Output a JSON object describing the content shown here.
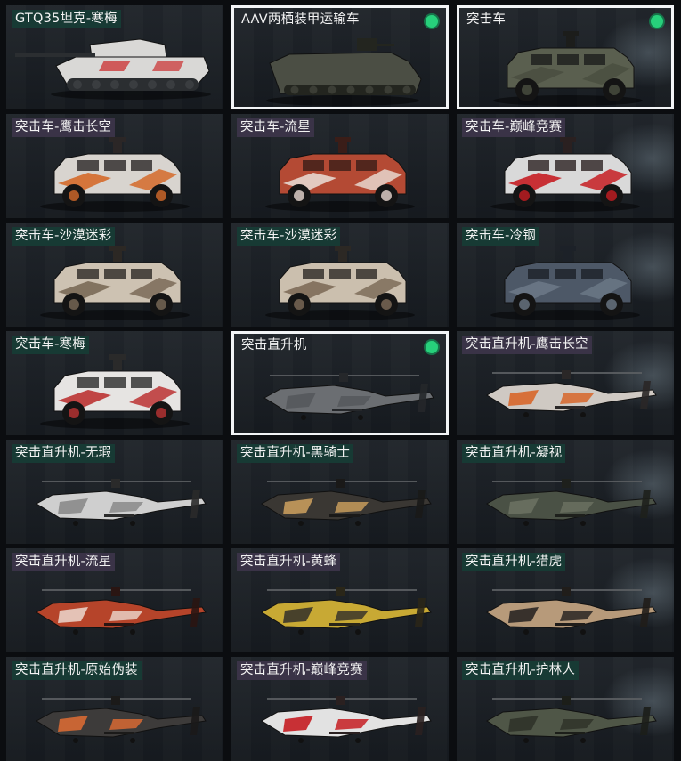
{
  "colors": {
    "background": "#0b0d10",
    "card": "#1a1f25",
    "selected_border": "#f2f4f6",
    "check": "#27d07b",
    "tag_teal": "#173a34",
    "tag_purple": "#3a3347"
  },
  "items": [
    {
      "label": "GTQ35坦克-寒梅",
      "kind": "tank",
      "selected": false,
      "check": false,
      "tag": "teal",
      "body": "#d9d8d6",
      "accent": "#c44",
      "dark": "#2b2e31"
    },
    {
      "label": "AAV两栖装甲运输车",
      "kind": "aav",
      "selected": true,
      "check": true,
      "tag": "none",
      "body": "#4b4e44",
      "accent": "#3d4037",
      "dark": "#23251f"
    },
    {
      "label": "突击车",
      "kind": "truck",
      "selected": true,
      "check": true,
      "tag": "none",
      "body": "#5a5f4f",
      "accent": "#4a4f40",
      "dark": "#1c1d1b"
    },
    {
      "label": "突击车-鹰击长空",
      "kind": "truck",
      "selected": false,
      "check": false,
      "tag": "purple",
      "body": "#d8d4cf",
      "accent": "#d56a2a",
      "dark": "#2b2626"
    },
    {
      "label": "突击车-流星",
      "kind": "truck",
      "selected": false,
      "check": false,
      "tag": "purple",
      "body": "#b44a34",
      "accent": "#e7d7cf",
      "dark": "#3a1d18"
    },
    {
      "label": "突击车-巅峰竞赛",
      "kind": "truck",
      "selected": false,
      "check": false,
      "tag": "purple",
      "body": "#d9d9d9",
      "accent": "#c51d22",
      "dark": "#2a2020"
    },
    {
      "label": "突击车-沙漠迷彩",
      "kind": "truck",
      "selected": false,
      "check": false,
      "tag": "teal",
      "body": "#cdc2b2",
      "accent": "#7a6a57",
      "dark": "#2c2824"
    },
    {
      "label": "突击车-沙漠迷彩",
      "kind": "truck",
      "selected": false,
      "check": false,
      "tag": "teal",
      "body": "#cbbfae",
      "accent": "#7e6c59",
      "dark": "#2c2824"
    },
    {
      "label": "突击车-冷钢",
      "kind": "truck",
      "selected": false,
      "check": false,
      "tag": "teal",
      "body": "#4d5867",
      "accent": "#6b7886",
      "dark": "#1c2128"
    },
    {
      "label": "突击车-寒梅",
      "kind": "truck",
      "selected": false,
      "check": false,
      "tag": "teal",
      "body": "#e6e4e2",
      "accent": "#b33",
      "dark": "#2a2a2a"
    },
    {
      "label": "突击直升机",
      "kind": "heli",
      "selected": true,
      "check": true,
      "tag": "none",
      "body": "#6b6e72",
      "accent": "#55585c",
      "dark": "#25272a"
    },
    {
      "label": "突击直升机-鹰击长空",
      "kind": "heli",
      "selected": false,
      "check": false,
      "tag": "purple",
      "body": "#cfc9c3",
      "accent": "#d7662a",
      "dark": "#2a2727"
    },
    {
      "label": "突击直升机-无瑕",
      "kind": "heli",
      "selected": false,
      "check": false,
      "tag": "teal",
      "body": "#cfcfcf",
      "accent": "#8a8a8a",
      "dark": "#2a2a2a"
    },
    {
      "label": "突击直升机-黑骑士",
      "kind": "heli",
      "selected": false,
      "check": false,
      "tag": "teal",
      "body": "#3a3733",
      "accent": "#c79b5c",
      "dark": "#1a1918"
    },
    {
      "label": "突击直升机-凝视",
      "kind": "heli",
      "selected": false,
      "check": false,
      "tag": "teal",
      "body": "#4a5145",
      "accent": "#6a7060",
      "dark": "#1e201c"
    },
    {
      "label": "突击直升机-流星",
      "kind": "heli",
      "selected": false,
      "check": false,
      "tag": "purple",
      "body": "#b6442a",
      "accent": "#e9d0c5",
      "dark": "#2a1512"
    },
    {
      "label": "突击直升机-黄蜂",
      "kind": "heli",
      "selected": false,
      "check": false,
      "tag": "purple",
      "body": "#c8a934",
      "accent": "#3a352a",
      "dark": "#2a2618"
    },
    {
      "label": "突击直升机-猎虎",
      "kind": "heli",
      "selected": false,
      "check": false,
      "tag": "teal",
      "body": "#b79a7a",
      "accent": "#2a2623",
      "dark": "#201d1a"
    },
    {
      "label": "突击直升机-原始伪装",
      "kind": "heli",
      "selected": false,
      "check": false,
      "tag": "teal",
      "body": "#3d3b3a",
      "accent": "#d76a34",
      "dark": "#1b1a19"
    },
    {
      "label": "突击直升机-巅峰竞赛",
      "kind": "heli",
      "selected": false,
      "check": false,
      "tag": "purple",
      "body": "#e2e2e2",
      "accent": "#c51d22",
      "dark": "#2a2020"
    },
    {
      "label": "突击直升机-护林人",
      "kind": "heli",
      "selected": false,
      "check": false,
      "tag": "teal",
      "body": "#4f5647",
      "accent": "#2f3329",
      "dark": "#1c1e19"
    }
  ]
}
